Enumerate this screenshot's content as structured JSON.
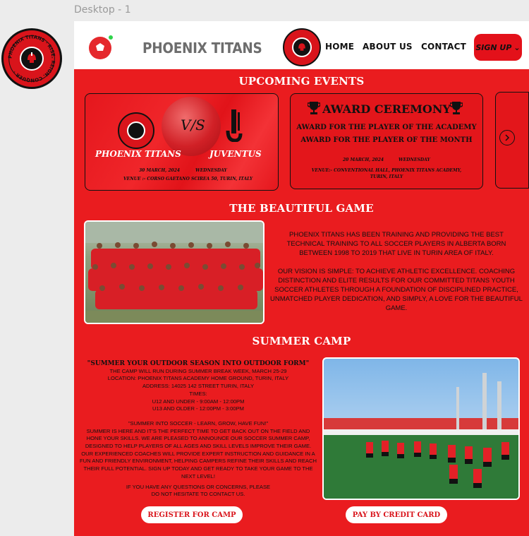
{
  "canvas": {
    "label": "Desktop - 1"
  },
  "header": {
    "brand": "PHOENIX TITANS",
    "nav": [
      "HOME",
      "ABOUT US",
      "CONTACT"
    ],
    "signup_label": "SIGN UP"
  },
  "logo": {
    "ring_text": "PHOENIX TITANS · RISE. REIGN. CONQUER"
  },
  "events": {
    "title": "UPCOMING EVENTS",
    "match": {
      "home": "PHOENIX TITANS",
      "vs": "V/S",
      "away": "JUVENTUS",
      "date": "30 MARCH, 2024",
      "day": "WEDNESDAY",
      "venue": "VENUE :- CORSO GAETANO SCIREA 50, TURIN, ITALY"
    },
    "award": {
      "title": "AWARD CEREMONY",
      "line1": "AWARD  FOR THE PLAYER OF THE ACADEMY",
      "line2": "AWARD  FOR THE PLAYER OF THE MONTH",
      "date": "20 MARCH, 2024",
      "day": "WEDNESDAY",
      "venue": "VENUE:- CONVENTIONAL HALL, PHOENIX TITANS ACADEMY, TURIN, ITALY"
    }
  },
  "game": {
    "title": "THE BEAUTIFUL GAME",
    "para1": "PHOENIX TITANS HAS BEEN TRAINING AND PROVIDING THE BEST TECHNICAL TRAINING TO ALL SOCCER PLAYERS IN ALBERTA BORN BETWEEN 1998 TO 2019 THAT LIVE IN TURIN AREA OF ITALY.",
    "para2": "OUR VISION IS SIMPLE: TO ACHIEVE ATHLETIC EXCELLENCE. COACHING DISTINCTION AND ELITE RESULTS FOR OUR COMMITTED TITANS YOUTH SOCCER ATHLETES THROUGH A FOUNDATION OF DISCIPLINED PRACTICE, UNMATCHED PLAYER DEDICATION, AND SIMPLY, A LOVE FOR THE BEAUTIFUL GAME."
  },
  "camp": {
    "title": "SUMMER CAMP",
    "headline": "\"SUMMER YOUR OUTDOOR SEASON INTO OUTDOOR FORM\"",
    "lines": [
      "THE CAMP WILL RUN DURING SUMMER BREAK WEEK, MARCH 25-29",
      "LOCATION: PHOENIX TITANS ACADEMY HOME GROUND, TURIN, ITALY",
      "ADDRESS: 14025 142 STREET TURIN, ITALY",
      "TIMES:",
      "U12 AND UNDER - 9:00AM - 12:00PM",
      "U13 AND OLDER - 12:00PM - 3:00PM"
    ],
    "tagline": "\"SUMMER INTO SOCCER - LEARN, GROW, HAVE FUN!\"",
    "description": "SUMMER IS HERE AND IT'S THE PERFECT TIME TO GET BACK OUT ON THE FIELD AND HONE YOUR SKILLS. WE ARE PLEASED TO ANNOUNCE OUR SOCCER SUMMER CAMP, DESIGNED TO HELP PLAYERS OF ALL AGES AND SKILL LEVELS IMPROVE THEIR GAME. OUR EXPERIENCED COACHES WILL PROVIDE EXPERT INSTRUCTION AND GUIDANCE IN A FUN AND FRIENDLY ENVIRONMENT, HELPING CAMPERS REFINE THEIR SKILLS AND REACH THEIR FULL POTENTIAL. SIGN UP TODAY AND GET READY TO TAKE YOUR GAME TO THE NEXT LEVEL!",
    "contact": "IF YOU HAVE ANY QUESTIONS OR CONCERNS, PLEASE DO NOT HESITATE TO CONTACT US.",
    "register_label": "REGISTER FOR CAMP",
    "pay_label": "PAY BY CREDIT CARD"
  },
  "colors": {
    "brand_red": "#ea1c1f",
    "dark": "#111111",
    "white": "#ffffff"
  }
}
